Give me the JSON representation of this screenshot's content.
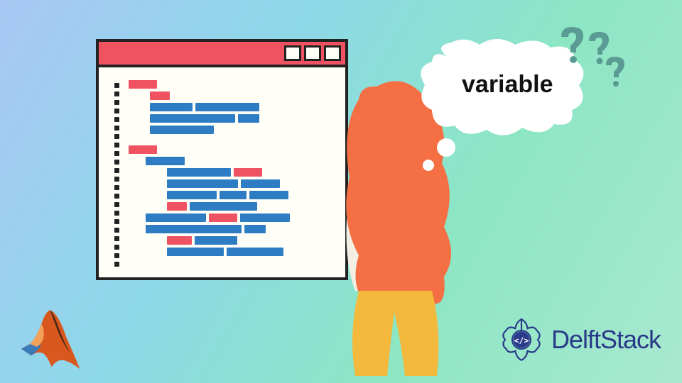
{
  "bubble_label": "variable",
  "brand": "DelftStack",
  "colors": {
    "accent_red": "#ef5362",
    "accent_blue": "#2d7cc4",
    "brand_blue": "#2a3a8a"
  },
  "logos": {
    "bottom_left": "matlab-logo",
    "bottom_right": "delftstack-logo"
  }
}
